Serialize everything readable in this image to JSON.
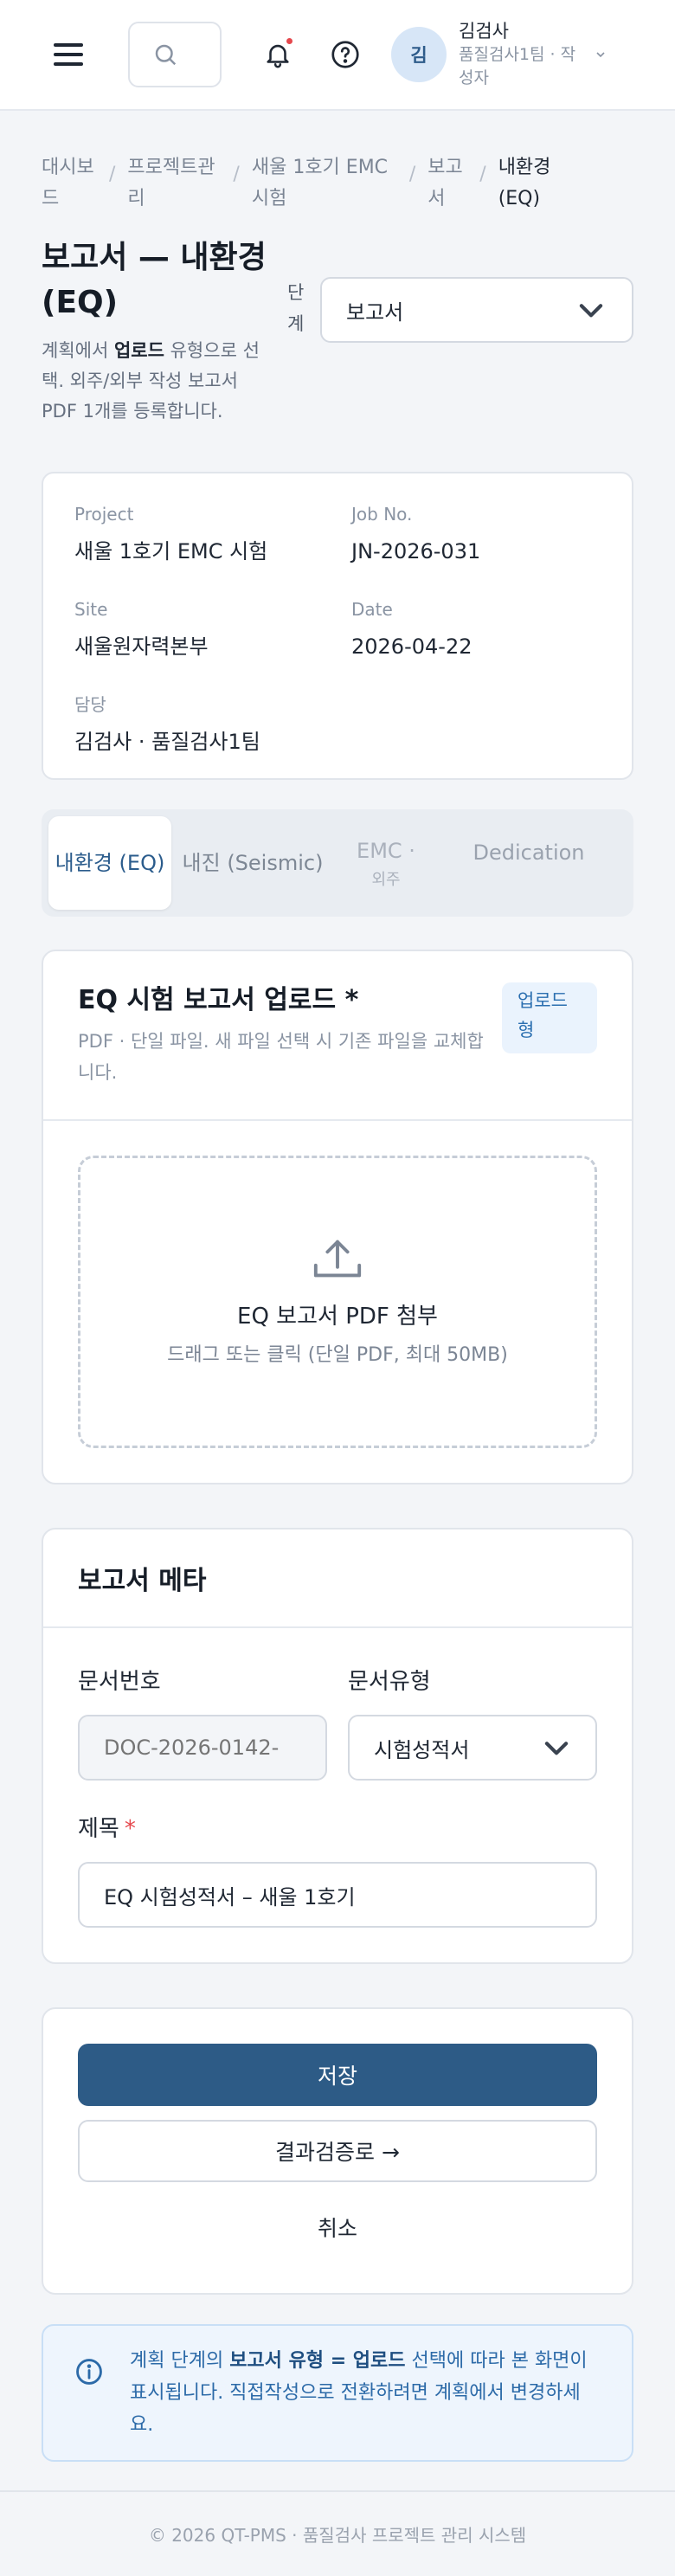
{
  "user": {
    "avatar_initial": "김",
    "name": "김검사",
    "role": "품질검사1팀 · 작성자"
  },
  "breadcrumb": {
    "items": [
      "대시보드",
      "프로젝트관리",
      "새울 1호기 EMC 시험",
      "보고서"
    ],
    "current": "내환경 (EQ)",
    "separator": "/"
  },
  "page": {
    "title": "보고서 — 내환경 (EQ)",
    "desc_prefix": "계획에서 ",
    "desc_bold": "업로드",
    "desc_suffix": " 유형으로 선택. 외주/외부 작성 보고서 PDF 1개를 등록합니다."
  },
  "stage": {
    "label": "단계",
    "value": "보고서"
  },
  "project_info": {
    "project_label": "Project",
    "project_value": "새울 1호기 EMC 시험",
    "job_label": "Job No.",
    "job_value": "JN-2026-031",
    "site_label": "Site",
    "site_value": "새울원자력본부",
    "date_label": "Date",
    "date_value": "2026-04-22",
    "owner_label": "담당",
    "owner_value": "김검사 · 품질검사1팀"
  },
  "tabs": {
    "eq": "내환경 (EQ)",
    "seismic": "내진 (Seismic)",
    "emc": "EMC ·",
    "emc_sub": "외주",
    "dedication": "Dedication"
  },
  "upload": {
    "title": "EQ 시험 보고서 업로드 *",
    "desc": "PDF · 단일 파일. 새 파일 선택 시 기존 파일을 교체합니다.",
    "badge": "업로드형",
    "drop_title": "EQ 보고서 PDF 첨부",
    "drop_hint": "드래그 또는 클릭 (단일 PDF, 최대 50MB)"
  },
  "meta": {
    "title": "보고서 메타",
    "doc_no_label": "문서번호",
    "doc_no_placeholder": "DOC-2026-0142-",
    "doc_type_label": "문서유형",
    "doc_type_value": "시험성적서",
    "title_label": "제목",
    "title_required": "*",
    "title_value": "EQ 시험성적서 – 새울 1호기"
  },
  "actions": {
    "save": "저장",
    "next": "결과검증로 →",
    "cancel": "취소"
  },
  "notice": {
    "prefix": "계획 단계의 ",
    "bold": "보고서 유형 = 업로드",
    "suffix": " 선택에 따라 본 화면이 표시됩니다. 직접작성으로 전환하려면 계획에서 변경하세요."
  },
  "footer": "© 2026 QT-PMS · 품질검사 프로젝트 관리 시스템",
  "colors": {
    "primary": "#2d5b86",
    "accent": "#2b6fb0",
    "danger": "#e5484d"
  }
}
